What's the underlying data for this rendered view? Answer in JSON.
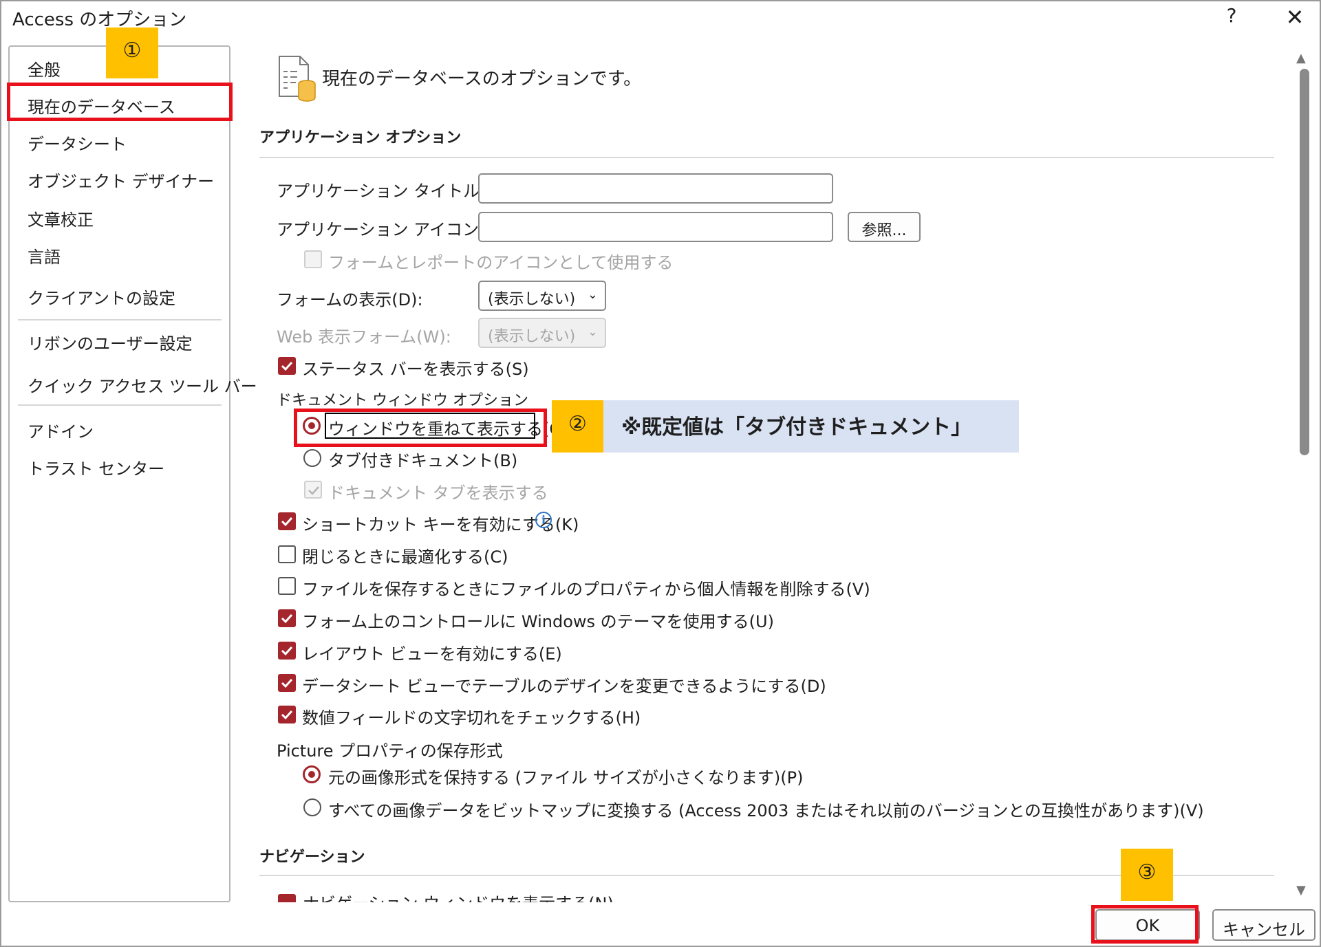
{
  "window": {
    "title": "Access のオプション",
    "help_label": "?",
    "close_label": "✕"
  },
  "sidebar": {
    "items": [
      {
        "label": "全般"
      },
      {
        "label": "現在のデータベース"
      },
      {
        "label": "データシート"
      },
      {
        "label": "オブジェクト デザイナー"
      },
      {
        "label": "文章校正"
      },
      {
        "label": "言語"
      },
      {
        "label": "クライアントの設定"
      },
      {
        "label": "リボンのユーザー設定"
      },
      {
        "label": "クイック アクセス ツール バー"
      },
      {
        "label": "アドイン"
      },
      {
        "label": "トラスト センター"
      }
    ],
    "selected": "現在のデータベース"
  },
  "callouts": {
    "step1": "①",
    "step2": "②",
    "step3": "③",
    "note": "※既定値は「タブ付きドキュメント」"
  },
  "header": {
    "text": "現在のデータベースのオプションです。",
    "icon": "database-options-icon"
  },
  "app_options": {
    "title": "アプリケーション オプション",
    "app_title_label": "アプリケーション タイトル(T):",
    "app_title_value": "",
    "app_icon_label": "アプリケーション アイコン(I):",
    "app_icon_value": "",
    "browse_label": "参照...",
    "use_as_icon_label": "フォームとレポートのアイコンとして使用する",
    "use_as_icon_checked": false,
    "display_form_label": "フォームの表示(D):",
    "display_form_value": "(表示しない)",
    "web_form_label": "Web 表示フォーム(W):",
    "web_form_value": "(表示しない)",
    "status_bar_label": "ステータス バーを表示する(S)",
    "status_bar_checked": true,
    "doc_window_label": "ドキュメント ウィンドウ オプション",
    "overlapping_label": "ウィンドウを重ねて表示する(O)",
    "overlapping_selected": true,
    "tabbed_label": "タブ付きドキュメント(B)",
    "tabbed_selected": false,
    "doc_tabs_label": "ドキュメント タブを表示する",
    "doc_tabs_checked": true,
    "shortcut_keys_label": "ショートカット キーを有効にする(K)",
    "shortcut_keys_checked": true,
    "compact_on_close_label": "閉じるときに最適化する(C)",
    "compact_on_close_checked": false,
    "remove_personal_label": "ファイルを保存するときにファイルのプロパティから個人情報を削除する(V)",
    "remove_personal_checked": false,
    "windows_theme_label": "フォーム上のコントロールに Windows のテーマを使用する(U)",
    "windows_theme_checked": true,
    "layout_view_label": "レイアウト ビューを有効にする(E)",
    "layout_view_checked": true,
    "datasheet_design_label": "データシート ビューでテーブルのデザインを変更できるようにする(D)",
    "datasheet_design_checked": true,
    "numeric_truncation_label": "数値フィールドの文字切れをチェックする(H)",
    "numeric_truncation_checked": true,
    "picture_format_label": "Picture プロパティの保存形式",
    "preserve_format_label": "元の画像形式を保持する (ファイル サイズが小さくなります)(P)",
    "preserve_format_selected": true,
    "convert_bitmap_label": "すべての画像データをビットマップに変換する (Access 2003 またはそれ以前のバージョンとの互換性があります)(V)",
    "convert_bitmap_selected": false
  },
  "navigation": {
    "title": "ナビゲーション",
    "show_nav_pane_label": "ナビゲーション ウィンドウを表示する(N)",
    "show_nav_pane_checked": true
  },
  "footer": {
    "ok_label": "OK",
    "cancel_label": "キャンセル"
  },
  "colors": {
    "accent": "#a4262c",
    "highlight_red": "#e8101a",
    "callout_yellow": "#ffc000",
    "note_blue": "#d9e2f3"
  }
}
